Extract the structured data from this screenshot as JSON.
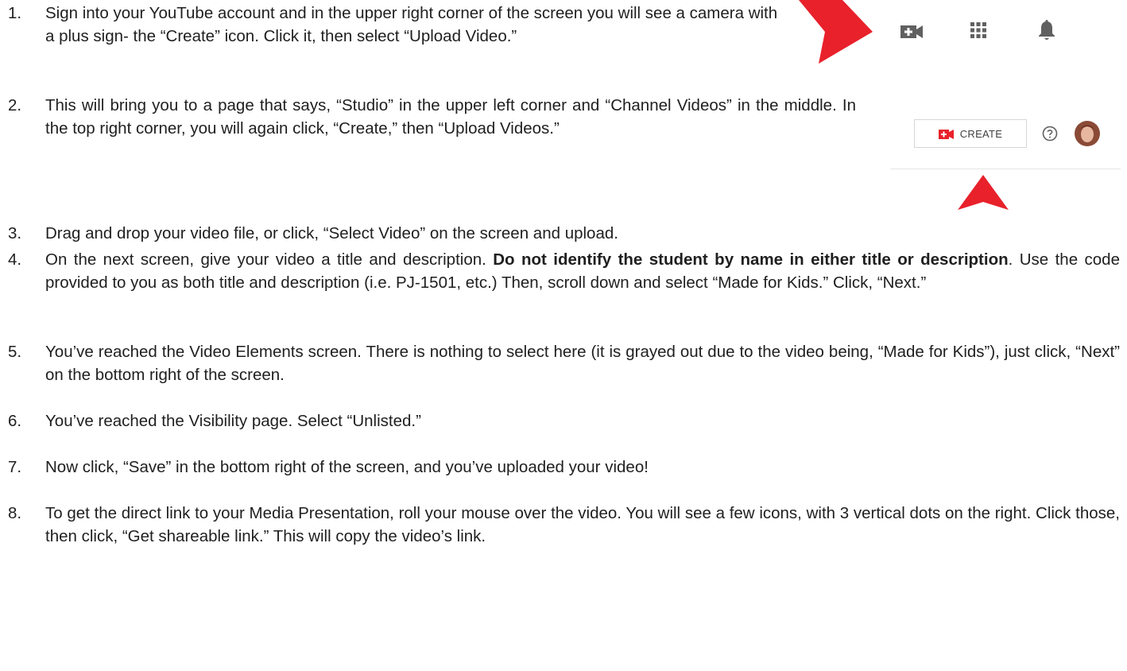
{
  "steps": [
    {
      "num": "1.",
      "text": "Sign into your YouTube account and in the upper right corner of the screen you will see a camera with a plus sign- the “Create” icon. Click it, then select “Upload Video.”"
    },
    {
      "num": "2.",
      "text": "This will bring you to a page that says, “Studio” in the upper left corner and “Channel Videos” in the middle. In the top right corner, you will again click, “Create,” then “Upload Videos.”"
    },
    {
      "num": "3.",
      "text": "Drag and drop your video file, or click, “Select Video” on the screen and upload."
    },
    {
      "num": "4.",
      "text_pre": "On the next screen, give your video a title and description. ",
      "text_bold": "Do not identify the student by name in either title or description",
      "text_post": ". Use the code provided to you as both title and description (i.e. PJ-1501, etc.) Then, scroll down and select “Made for Kids.” Click, “Next.”"
    },
    {
      "num": "5.",
      "text": "You’ve reached the Video Elements screen. There is nothing to select here (it is grayed out due to the video being, “Made for Kids”), just click, “Next” on the bottom right of the screen."
    },
    {
      "num": "6.",
      "text": "You’ve reached the Visibility page. Select “Unlisted.”"
    },
    {
      "num": "7.",
      "text": "Now click, “Save” in the bottom right of the screen, and you’ve uploaded your video!"
    },
    {
      "num": "8.",
      "text": "To get the direct link to your Media Presentation, roll your mouse over the video. You will see a few icons, with 3 vertical dots on the right. Click those, then click, “Get shareable link.” This will copy the video’s link."
    }
  ],
  "screenshot2": {
    "create_label": "CREATE"
  },
  "colors": {
    "arrow": "#e8212b",
    "icon_gray": "#606060",
    "text": "#1f1f1f"
  }
}
